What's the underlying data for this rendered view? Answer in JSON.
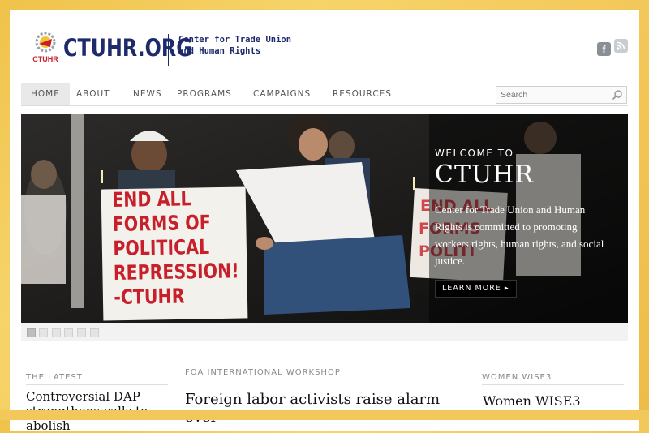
{
  "brand": {
    "logo_text": "CTUHR.ORG",
    "emblem_text": "CTUHR",
    "tagline": "Center for Trade Union\nand Human Rights"
  },
  "social": {
    "facebook": "f",
    "rss": "rss-icon"
  },
  "nav": {
    "items": [
      {
        "label": "HOME",
        "active": true
      },
      {
        "label": "ABOUT"
      },
      {
        "label": "NEWS"
      },
      {
        "label": "PROGRAMS"
      },
      {
        "label": "CAMPAIGNS"
      },
      {
        "label": "RESOURCES"
      }
    ]
  },
  "search": {
    "placeholder": "Search",
    "value": ""
  },
  "hero": {
    "sign_text": "END ALL\nFORMS OF\nPOLITICAL\nREPRESSION!\n-CTUHR",
    "kicker": "WELCOME TO",
    "title": "CTUHR",
    "body": "Center for Trade Union and Human Rights is committed to promoting workers rights, human rights, and social justice.",
    "button": "LEARN MORE ▸",
    "slide_count": 6,
    "active_slide": 1
  },
  "columns": [
    {
      "heading": "THE LATEST",
      "title": "Controversial DAP strengthens calls to abolish"
    },
    {
      "heading": "FOA INTERNATIONAL WORKSHOP",
      "title": "Foreign labor activists raise alarm over"
    },
    {
      "heading": "WOMEN WISE3",
      "title": "Women WISE3"
    }
  ],
  "colors": {
    "brand_navy": "#1d2a6b",
    "sign_red": "#c8202b",
    "frame_gold": "#f3c85a"
  }
}
